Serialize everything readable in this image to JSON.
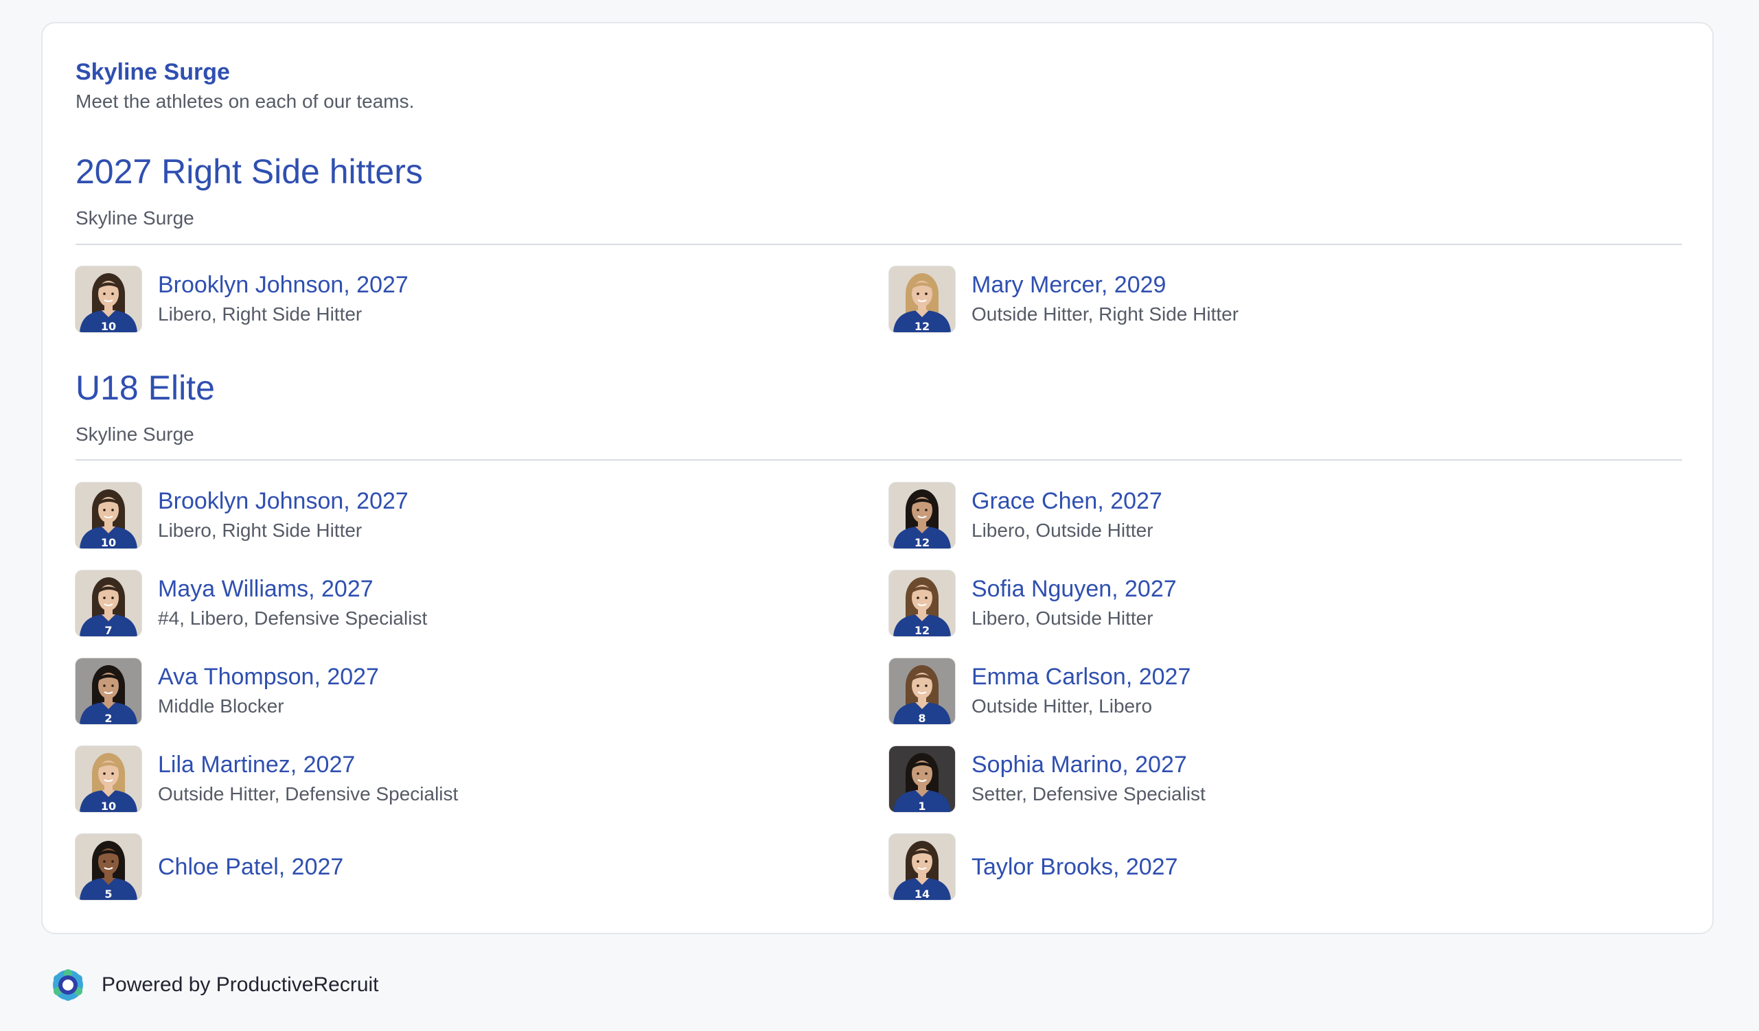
{
  "organization": {
    "name": "Skyline Surge",
    "description": "Meet the athletes on each of our teams."
  },
  "teams": [
    {
      "title": "2027 Right Side hitters",
      "club": "Skyline Surge",
      "athletes": [
        {
          "name": "Brooklyn Johnson, 2027",
          "positions": "Libero, Right Side Hitter",
          "jersey": "10"
        },
        {
          "name": "Mary Mercer, 2029",
          "positions": "Outside Hitter, Right Side Hitter",
          "jersey": "12"
        }
      ]
    },
    {
      "title": "U18 Elite",
      "club": "Skyline Surge",
      "athletes": [
        {
          "name": "Brooklyn Johnson, 2027",
          "positions": "Libero, Right Side Hitter",
          "jersey": "10"
        },
        {
          "name": "Grace Chen, 2027",
          "positions": "Libero, Outside Hitter",
          "jersey": "12"
        },
        {
          "name": "Maya Williams, 2027",
          "positions": "#4, Libero, Defensive Specialist",
          "jersey": "7"
        },
        {
          "name": "Sofia Nguyen, 2027",
          "positions": "Libero, Outside Hitter",
          "jersey": "12"
        },
        {
          "name": "Ava Thompson, 2027",
          "positions": "Middle Blocker",
          "jersey": "2"
        },
        {
          "name": "Emma Carlson, 2027",
          "positions": "Outside Hitter, Libero",
          "jersey": "8"
        },
        {
          "name": "Lila Martinez, 2027",
          "positions": "Outside Hitter, Defensive Specialist",
          "jersey": "10"
        },
        {
          "name": "Sophia Marino, 2027",
          "positions": "Setter, Defensive Specialist",
          "jersey": "1"
        },
        {
          "name": "Chloe Patel, 2027",
          "positions": "",
          "jersey": "5"
        },
        {
          "name": "Taylor Brooks, 2027",
          "positions": "",
          "jersey": "14"
        }
      ]
    }
  ],
  "footer": {
    "text": "Powered by ProductiveRecruit",
    "logo_icon": "productiverecruit-logo-icon"
  },
  "colors": {
    "accent": "#2f4fb0",
    "muted_text": "#555b66",
    "jersey": "#1f3f8f"
  }
}
